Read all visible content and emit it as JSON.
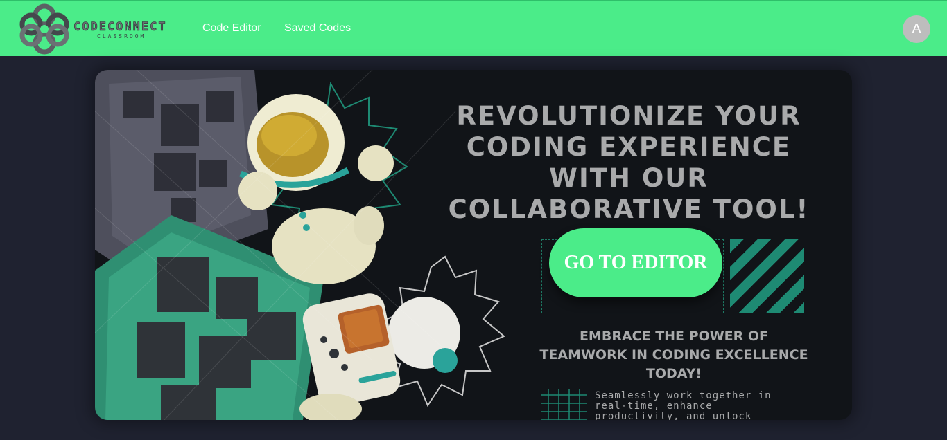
{
  "brand": {
    "name": "CODECONNECT",
    "subtitle": "CLASSROOM",
    "accent_color": "#4bec89",
    "background_color": "#1f2230"
  },
  "nav": {
    "links": [
      {
        "label": "Code Editor"
      },
      {
        "label": "Saved Codes"
      }
    ],
    "avatar_initial": "A"
  },
  "hero": {
    "headline": "REVOLUTIONIZE YOUR CODING EXPERIENCE WITH OUR COLLABORATIVE TOOL!",
    "cta_label": "GO TO EDITOR",
    "subheadline": "EMBRACE THE POWER OF TEAMWORK IN CODING EXCELLENCE TODAY!",
    "body": "Seamlessly work together in real-time, enhance productivity, and unlock limitless potential",
    "illustration_icon": "astronaut-illustration-icon"
  }
}
